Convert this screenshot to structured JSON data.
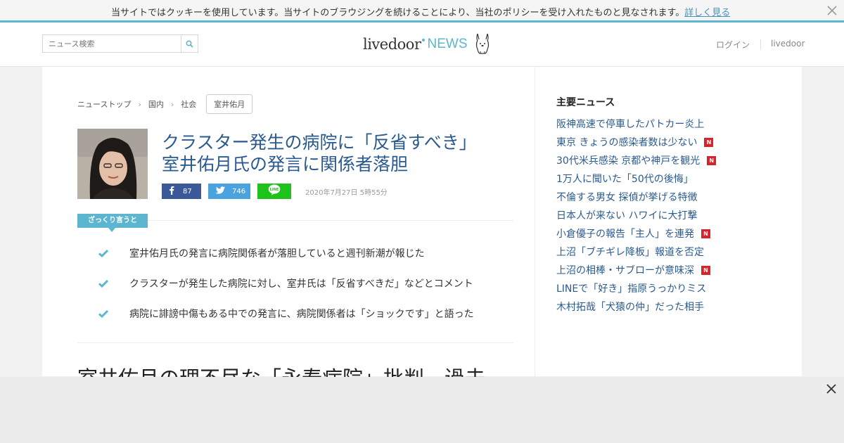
{
  "cookie": {
    "message": "当サイトではクッキーを使用しています。当サイトのブラウジングを続けることにより、当社のポリシーを受け入れたものと見なされます。",
    "link": "詳しく見る",
    "close_icon": "close-icon"
  },
  "header": {
    "search_placeholder": "ニュース検索",
    "search_icon": "search-icon",
    "logo_main": "livedoor",
    "logo_news": "NEWS",
    "login": "ログイン",
    "livedoor": "livedoor"
  },
  "breadcrumb": {
    "items": [
      "ニューストップ",
      "国内",
      "社会"
    ],
    "tag": "室井佑月"
  },
  "article": {
    "title_line1": "クラスター発生の病院に「反省すべき」",
    "title_line2": "室井佑月氏の発言に関係者落胆",
    "facebook_count": "87",
    "twitter_count": "746",
    "date": "2020年7月27日 5時55分",
    "summary_label": "ざっくり言うと",
    "bullets": [
      "室井佑月氏の発言に病院関係者が落胆していると週刊新潮が報じた",
      "クラスターが発生した病院に対し、室井氏は「反省すべきだ」などとコメント",
      "病院に誹謗中傷もある中での発言に、病院関係者は「ショックです」と語った"
    ],
    "next_heading": "室井佑月の理不尽な「永寿病院」批判　過去"
  },
  "sidebar": {
    "title": "主要ニュース",
    "badge": "N",
    "items": [
      {
        "text": "阪神高速で停車したパトカー炎上",
        "new": false
      },
      {
        "text": "東京 きょうの感染者数は少ない",
        "new": true
      },
      {
        "text": "30代米兵感染 京都や神戸を観光",
        "new": true
      },
      {
        "text": "1万人に聞いた「50代の後悔」",
        "new": false
      },
      {
        "text": "不倫する男女 探偵が挙げる特徴",
        "new": false
      },
      {
        "text": "日本人が来ない ハワイに大打撃",
        "new": false
      },
      {
        "text": "小倉優子の報告「主人」を連発",
        "new": true
      },
      {
        "text": "上沼「ブチギレ降板」報道を否定",
        "new": false
      },
      {
        "text": "上沼の相棒・サブローが意味深",
        "new": true
      },
      {
        "text": "LINEで「好き」指原うっかりミス",
        "new": false
      },
      {
        "text": "木村拓哉「犬猿の仲」だった相手",
        "new": false
      }
    ]
  },
  "colors": {
    "accent": "#5db6cf",
    "link": "#2b5a8e",
    "facebook": "#3b5998",
    "twitter": "#4aa3df",
    "line": "#1dc21a",
    "new_badge": "#d8232a"
  }
}
